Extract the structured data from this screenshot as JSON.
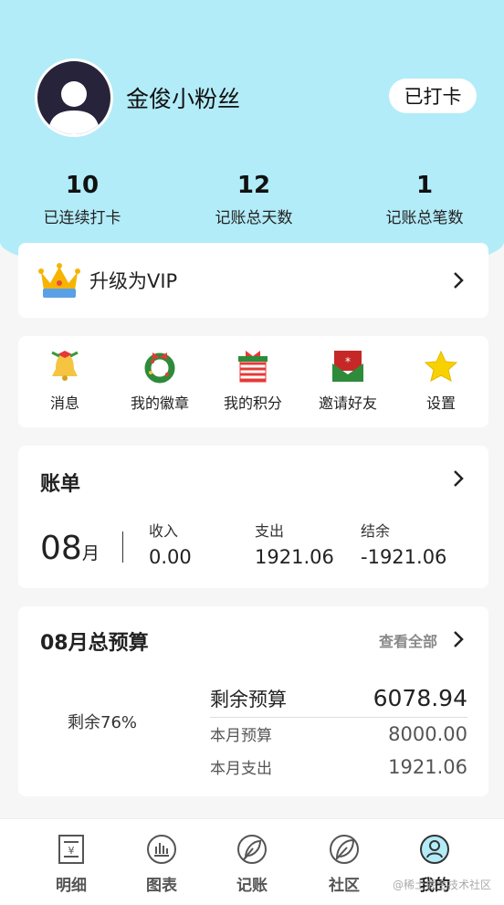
{
  "profile": {
    "username": "金俊小粉丝",
    "checkin_label": "已打卡"
  },
  "stats": [
    {
      "value": "10",
      "label": "已连续打卡"
    },
    {
      "value": "12",
      "label": "记账总天数"
    },
    {
      "value": "1",
      "label": "记账总笔数"
    }
  ],
  "vip": {
    "label": "升级为VIP",
    "icon": "crown-icon"
  },
  "quick_actions": [
    {
      "label": "消息",
      "icon": "bell-icon"
    },
    {
      "label": "我的徽章",
      "icon": "wreath-icon"
    },
    {
      "label": "我的积分",
      "icon": "gift-box-icon"
    },
    {
      "label": "邀请好友",
      "icon": "envelope-icon"
    },
    {
      "label": "设置",
      "icon": "star-icon"
    }
  ],
  "bill": {
    "title": "账单",
    "month": "08",
    "month_unit": "月",
    "income_label": "收入",
    "income_value": "0.00",
    "expense_label": "支出",
    "expense_value": "1921.06",
    "balance_label": "结余",
    "balance_value": "-1921.06"
  },
  "budget": {
    "title": "08月总预算",
    "view_all": "查看全部",
    "remaining_pct_label": "剩余76%",
    "remaining_label": "剩余预算",
    "remaining_value": "6078.94",
    "monthly_label": "本月预算",
    "monthly_value": "8000.00",
    "spent_label": "本月支出",
    "spent_value": "1921.06"
  },
  "tabs": [
    {
      "label": "明细",
      "icon": "receipt-icon",
      "active": false
    },
    {
      "label": "图表",
      "icon": "chart-icon",
      "active": false
    },
    {
      "label": "记账",
      "icon": "leaf-pen-icon",
      "active": false
    },
    {
      "label": "社区",
      "icon": "leaf-icon",
      "active": false
    },
    {
      "label": "我的",
      "icon": "user-icon",
      "active": true
    }
  ],
  "watermark": "@稀土掘金技术社区",
  "colors": {
    "header_bg": "#b2ecf8",
    "active_tab": "#b2ecf8",
    "page_bg": "#f6f6f6"
  }
}
